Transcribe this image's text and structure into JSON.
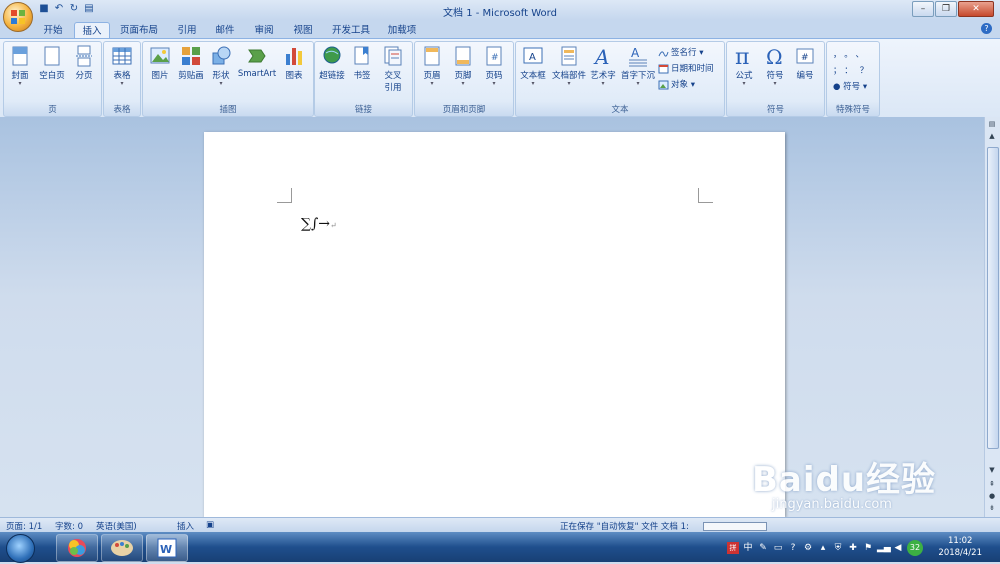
{
  "window": {
    "title": "文档 1 - Microsoft Word"
  },
  "qat": {
    "items": [
      "save-icon",
      "undo-icon",
      "redo-icon",
      "print-preview-icon"
    ]
  },
  "tabs": [
    "开始",
    "插入",
    "页面布局",
    "引用",
    "邮件",
    "审阅",
    "视图",
    "开发工具",
    "加载项"
  ],
  "active_tab": "插入",
  "ribbon": {
    "groups": {
      "page": "页",
      "table": "表格",
      "illustrations": "插图",
      "links": "链接",
      "header_footer": "页眉和页脚",
      "text": "文本",
      "symbols": "符号",
      "special": "特殊符号"
    },
    "buttons": {
      "cover": "封面",
      "blank": "空白页",
      "page_break": "分页",
      "table": "表格",
      "picture": "图片",
      "clipart": "剪贴画",
      "shapes": "形状",
      "smartart": "SmartArt",
      "chart": "图表",
      "hyperlink": "超链接",
      "bookmark": "书签",
      "crossref_1": "交叉",
      "crossref_2": "引用",
      "header": "页眉",
      "footer": "页脚",
      "page_number": "页码",
      "textbox": "文本框",
      "quickparts": "文档部件",
      "wordart": "艺术字",
      "dropcap": "首字下沉",
      "signature": "签名行",
      "datetime": "日期和时间",
      "object": "对象",
      "equation": "公式",
      "symbol": "符号",
      "numbering": "编号",
      "special_symbol": "符号"
    },
    "special_glyphs": [
      "，",
      "。",
      "、",
      "；",
      "：",
      "？"
    ]
  },
  "document": {
    "content": "∑∫→"
  },
  "statusbar": {
    "page": "页面: 1/1",
    "words": "字数: 0",
    "language": "英语(美国)",
    "mode": "插入",
    "saving": "正在保存 \"自动恢复\" 文件 文档 1:"
  },
  "taskbar": {
    "ime": "中",
    "badge": "32",
    "time": "11:02",
    "date": "2018/4/21"
  },
  "watermark": {
    "brand": "Baidu经验",
    "url": "jingyan.baidu.com"
  }
}
